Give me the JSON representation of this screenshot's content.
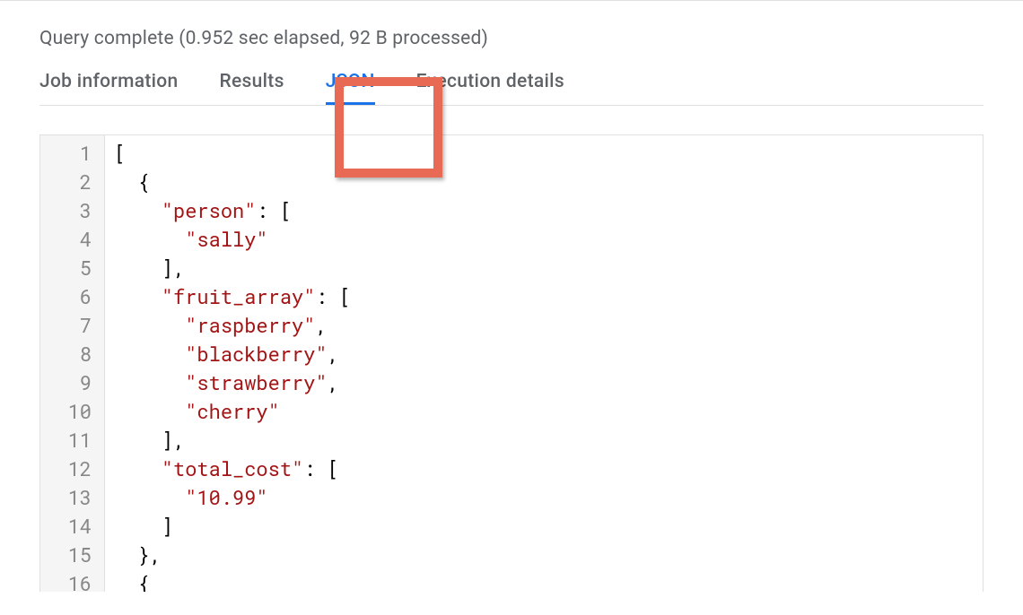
{
  "status": "Query complete (0.952 sec elapsed, 92 B processed)",
  "tabs": {
    "job_info": "Job information",
    "results": "Results",
    "json": "JSON",
    "execution": "Execution details",
    "active_index": 2
  },
  "code": {
    "line_count": 16,
    "lines": [
      {
        "t": "plain",
        "text": "["
      },
      {
        "t": "plain",
        "text": "  {"
      },
      {
        "t": "kv_start",
        "indent": "    ",
        "key": "\"person\"",
        "after": ": ["
      },
      {
        "t": "str",
        "indent": "      ",
        "val": "\"sally\""
      },
      {
        "t": "plain",
        "text": "    ],"
      },
      {
        "t": "kv_start",
        "indent": "    ",
        "key": "\"fruit_array\"",
        "after": ": ["
      },
      {
        "t": "str_c",
        "indent": "      ",
        "val": "\"raspberry\""
      },
      {
        "t": "str_c",
        "indent": "      ",
        "val": "\"blackberry\""
      },
      {
        "t": "str_c",
        "indent": "      ",
        "val": "\"strawberry\""
      },
      {
        "t": "str",
        "indent": "      ",
        "val": "\"cherry\""
      },
      {
        "t": "plain",
        "text": "    ],"
      },
      {
        "t": "kv_start",
        "indent": "    ",
        "key": "\"total_cost\"",
        "after": ": ["
      },
      {
        "t": "str",
        "indent": "      ",
        "val": "\"10.99\""
      },
      {
        "t": "plain",
        "text": "    ]"
      },
      {
        "t": "plain",
        "text": "  },"
      },
      {
        "t": "plain",
        "text": "  {"
      }
    ]
  }
}
